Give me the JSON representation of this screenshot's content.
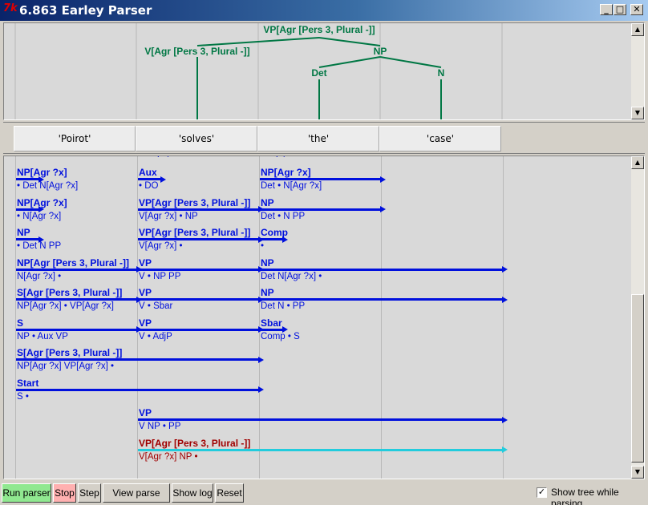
{
  "window": {
    "title": "6.863 Earley Parser",
    "app_icon_glyph": "7k"
  },
  "window_buttons": {
    "minimize": "_",
    "maximize": "□",
    "close": "✕"
  },
  "colors": {
    "tree": "#007744",
    "edge_complete": "#0010dd",
    "edge_selected_text": "#a00000",
    "edge_selected_bar": "#22ccdd",
    "dot": "•"
  },
  "tree": {
    "root": "VP[Agr [Pers 3, Plural -]]",
    "v": "V[Agr [Pers 3, Plural -]]",
    "np": "NP",
    "det": "Det",
    "n": "N"
  },
  "words": [
    "'Poirot'",
    "'solves'",
    "'the'",
    "'case'"
  ],
  "partial_labels": {
    "left": "~",
    "mid": "~.~ /",
    "right": "~.~/"
  },
  "edges": [
    {
      "lhs": "NP[Agr ?x]",
      "rhs": "• Det N[Agr ?x]",
      "col": 0,
      "span": 0,
      "row": 0
    },
    {
      "lhs": "Aux",
      "rhs": "• DO",
      "col": 1,
      "span": 0,
      "row": 0
    },
    {
      "lhs": "NP[Agr ?x]",
      "rhs": "Det • N[Agr ?x]",
      "col": 2,
      "span": 1,
      "row": 0
    },
    {
      "lhs": "NP[Agr ?x]",
      "rhs": "• N[Agr ?x]",
      "col": 0,
      "span": 0,
      "row": 1
    },
    {
      "lhs": "VP[Agr [Pers 3, Plural -]]",
      "rhs": "V[Agr ?x] • NP",
      "col": 1,
      "span": 1,
      "row": 1
    },
    {
      "lhs": "NP",
      "rhs": "Det • N PP",
      "col": 2,
      "span": 1,
      "row": 1
    },
    {
      "lhs": "NP",
      "rhs": "• Det N PP",
      "col": 0,
      "span": 0,
      "row": 2
    },
    {
      "lhs": "VP[Agr [Pers 3, Plural -]]",
      "rhs": "V[Agr ?x] •",
      "col": 1,
      "span": 1,
      "row": 2
    },
    {
      "lhs": "Comp",
      "rhs": "•",
      "col": 2,
      "span": 0,
      "row": 2
    },
    {
      "lhs": "NP[Agr [Pers 3, Plural -]]",
      "rhs": "N[Agr ?x] •",
      "col": 0,
      "span": 1,
      "row": 3
    },
    {
      "lhs": "VP",
      "rhs": "V • NP PP",
      "col": 1,
      "span": 1,
      "row": 3
    },
    {
      "lhs": "NP",
      "rhs": "Det N[Agr ?x] •",
      "col": 2,
      "span": 2,
      "row": 3
    },
    {
      "lhs": "S[Agr [Pers 3, Plural -]]",
      "rhs": "NP[Agr ?x] • VP[Agr ?x]",
      "col": 0,
      "span": 1,
      "row": 4
    },
    {
      "lhs": "VP",
      "rhs": "V • Sbar",
      "col": 1,
      "span": 1,
      "row": 4
    },
    {
      "lhs": "NP",
      "rhs": "Det N • PP",
      "col": 2,
      "span": 2,
      "row": 4
    },
    {
      "lhs": "S",
      "rhs": "NP • Aux VP",
      "col": 0,
      "span": 1,
      "row": 5
    },
    {
      "lhs": "VP",
      "rhs": "V • AdjP",
      "col": 1,
      "span": 1,
      "row": 5
    },
    {
      "lhs": "Sbar",
      "rhs": "Comp • S",
      "col": 2,
      "span": 0,
      "row": 5
    },
    {
      "lhs": "S[Agr [Pers 3, Plural -]]",
      "rhs": "NP[Agr ?x] VP[Agr ?x] •",
      "col": 0,
      "span": 2,
      "row": 6
    },
    {
      "lhs": "Start",
      "rhs": "S •",
      "col": 0,
      "span": 2,
      "row": 7
    },
    {
      "lhs": "VP",
      "rhs": "V NP • PP",
      "col": 1,
      "span": 3,
      "row": 8
    },
    {
      "lhs": "VP[Agr [Pers 3, Plural -]]",
      "rhs": "V[Agr ?x] NP •",
      "col": 1,
      "span": 3,
      "row": 9,
      "selected": true
    }
  ],
  "toolbar": {
    "run_parser": "Run parser",
    "stop": "Stop",
    "step": "Step",
    "view_parse_trees": "View parse trees",
    "show_log": "Show log",
    "reset": "Reset",
    "show_tree_label": "Show tree while parsing",
    "show_tree_checked": true,
    "check_glyph": "✓"
  }
}
